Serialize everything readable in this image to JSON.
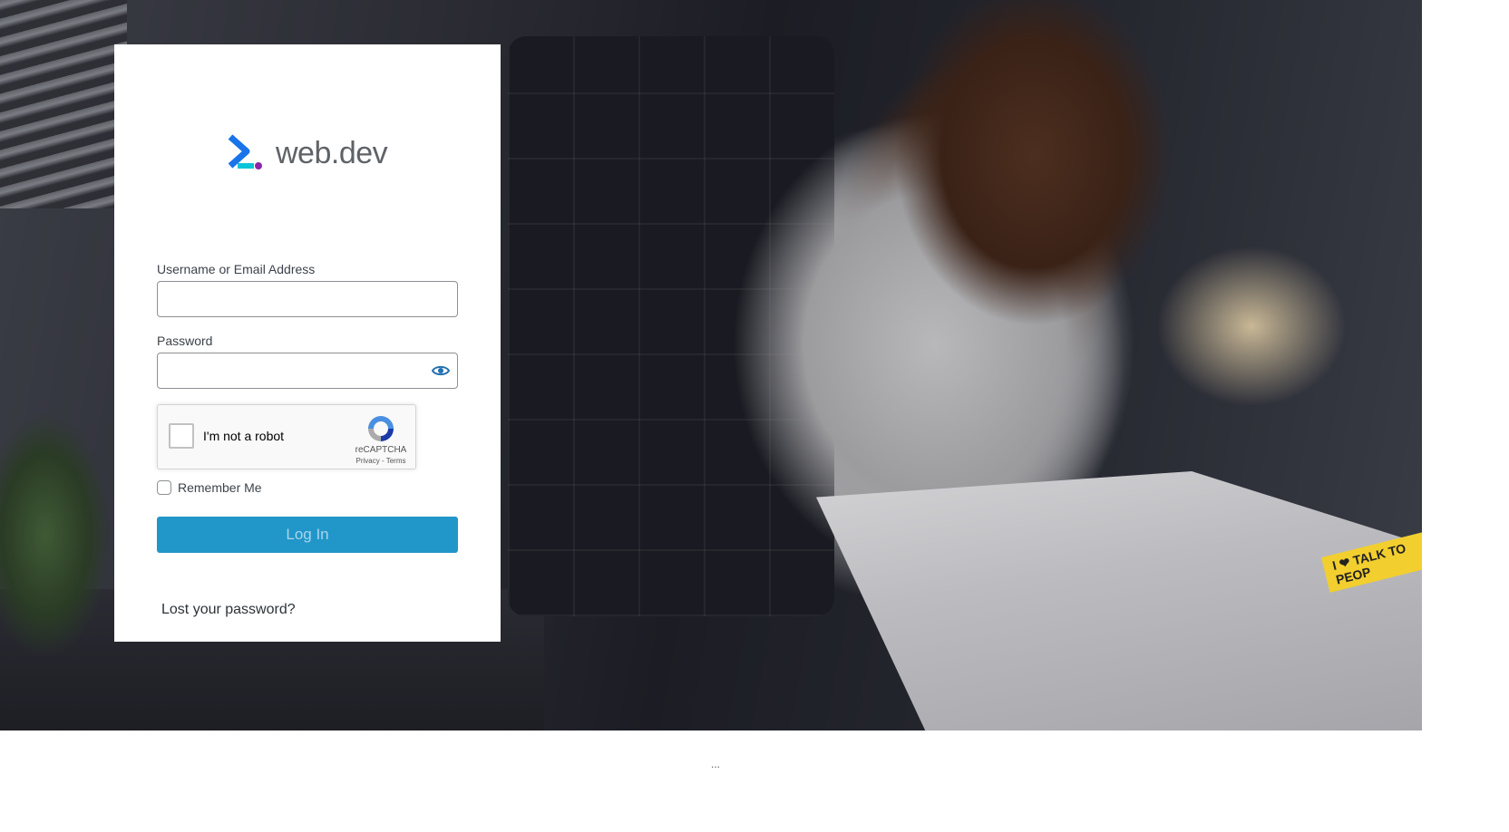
{
  "brand": {
    "name": "web.dev",
    "accent": "#1a73e8"
  },
  "form": {
    "username_label": "Username or Email Address",
    "username_value": "",
    "password_label": "Password",
    "password_value": "",
    "show_password_icon": "eye-icon",
    "remember_label": "Remember Me",
    "remember_checked": false,
    "submit_label": "Log In",
    "submit_color": "#2196c9"
  },
  "recaptcha": {
    "label": "I'm not a robot",
    "brand": "reCAPTCHA",
    "links": "Privacy - Terms"
  },
  "links": {
    "lost_password": "Lost your password?"
  },
  "footer": {
    "text": "..."
  },
  "background_photo": {
    "sticker_text": "I ❤ TALK TO PEOP"
  }
}
